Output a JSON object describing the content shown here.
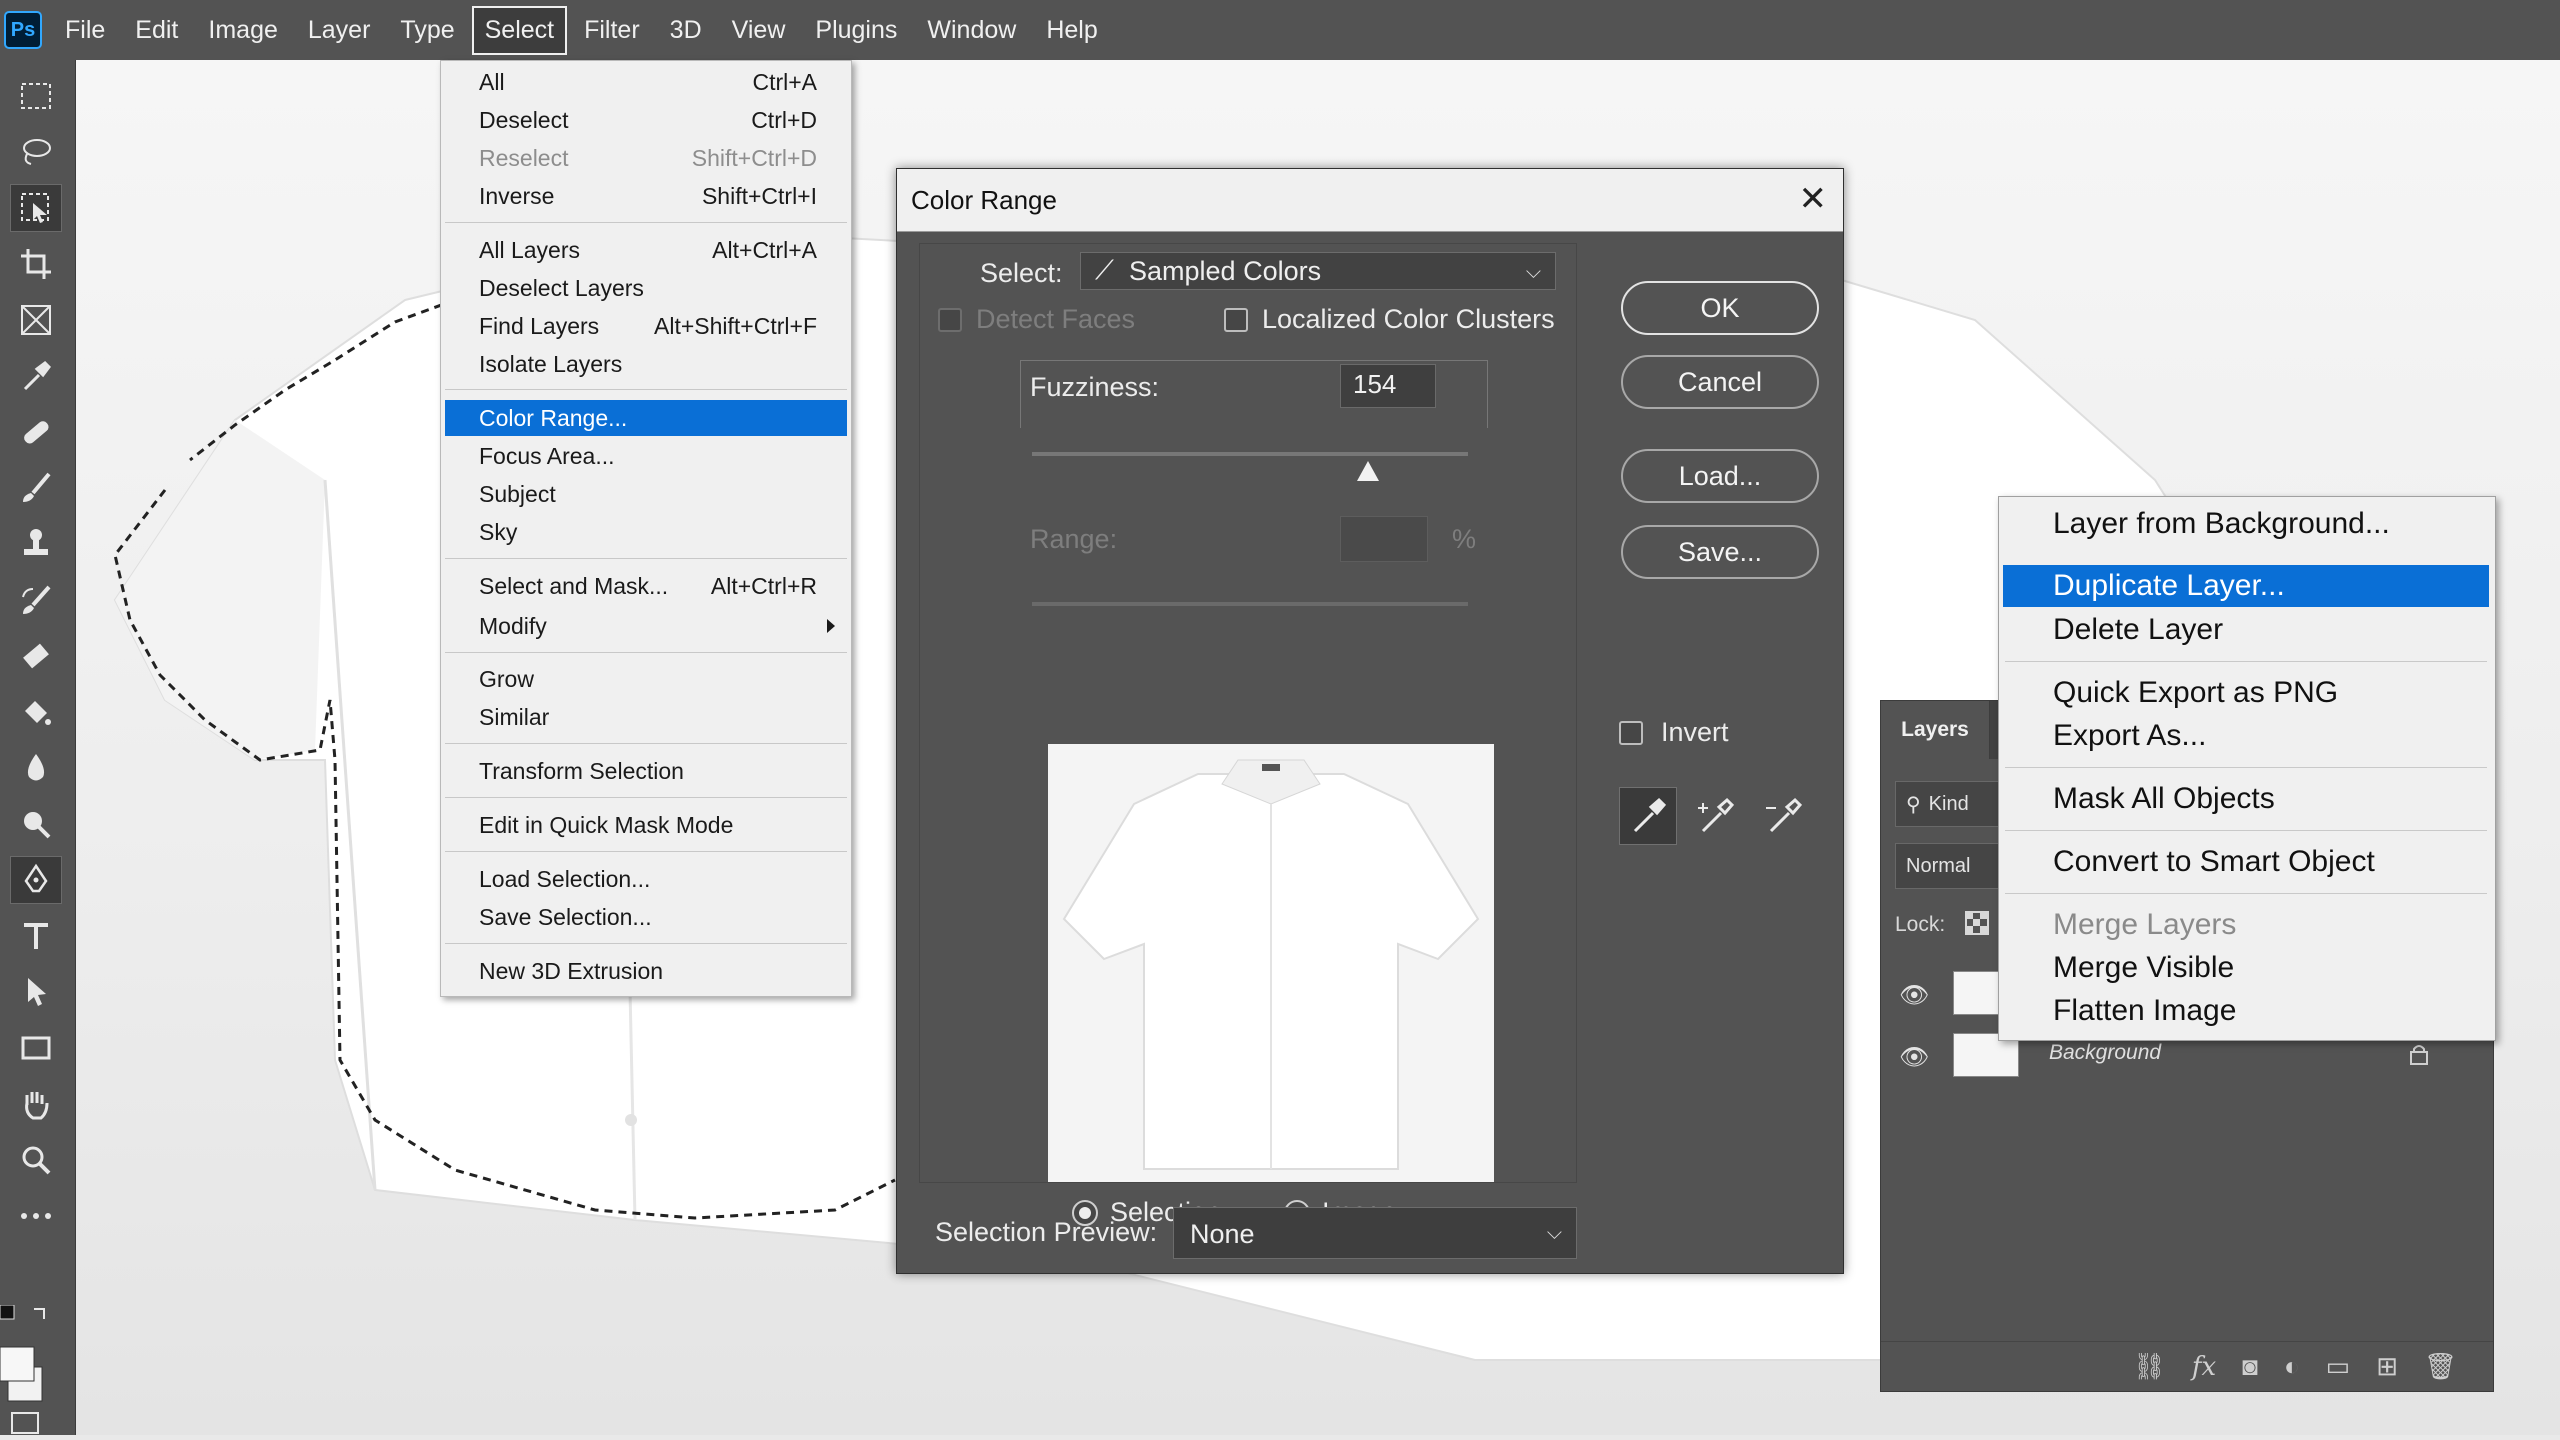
{
  "app": {
    "logo": "Ps"
  },
  "menubar": {
    "items": [
      "File",
      "Edit",
      "Image",
      "Layer",
      "Type",
      "Select",
      "Filter",
      "3D",
      "View",
      "Plugins",
      "Window",
      "Help"
    ],
    "active": "Select"
  },
  "select_menu": {
    "items": [
      {
        "label": "All",
        "shortcut": "Ctrl+A"
      },
      {
        "label": "Deselect",
        "shortcut": "Ctrl+D"
      },
      {
        "label": "Reselect",
        "shortcut": "Shift+Ctrl+D",
        "disabled": true
      },
      {
        "label": "Inverse",
        "shortcut": "Shift+Ctrl+I"
      },
      {
        "label": "All Layers",
        "shortcut": "Alt+Ctrl+A"
      },
      {
        "label": "Deselect Layers",
        "shortcut": ""
      },
      {
        "label": "Find Layers",
        "shortcut": "Alt+Shift+Ctrl+F"
      },
      {
        "label": "Isolate Layers",
        "shortcut": ""
      },
      {
        "label": "Color Range...",
        "shortcut": "",
        "highlighted": true
      },
      {
        "label": "Focus Area...",
        "shortcut": ""
      },
      {
        "label": "Subject",
        "shortcut": ""
      },
      {
        "label": "Sky",
        "shortcut": ""
      },
      {
        "label": "Select and Mask...",
        "shortcut": "Alt+Ctrl+R"
      },
      {
        "label": "Modify",
        "shortcut": "",
        "submenu": true
      },
      {
        "label": "Grow",
        "shortcut": ""
      },
      {
        "label": "Similar",
        "shortcut": ""
      },
      {
        "label": "Transform Selection",
        "shortcut": ""
      },
      {
        "label": "Edit in Quick Mask Mode",
        "shortcut": ""
      },
      {
        "label": "Load Selection...",
        "shortcut": ""
      },
      {
        "label": "Save Selection...",
        "shortcut": ""
      },
      {
        "label": "New 3D Extrusion",
        "shortcut": ""
      }
    ]
  },
  "color_range": {
    "title": "Color Range",
    "select_label": "Select:",
    "select_value": "Sampled Colors",
    "detect_faces": "Detect Faces",
    "localized": "Localized Color Clusters",
    "fuzziness_label": "Fuzziness:",
    "fuzziness_value": "154",
    "fuzziness_level": 0.77,
    "range_label": "Range:",
    "range_unit": "%",
    "radio_selection": "Selection",
    "radio_image": "Image",
    "preview_label": "Selection Preview:",
    "preview_value": "None",
    "buttons": {
      "ok": "OK",
      "cancel": "Cancel",
      "load": "Load...",
      "save": "Save..."
    },
    "invert": "Invert"
  },
  "layers_panel": {
    "tab": "Layers",
    "kind": "Kind",
    "blend": "Normal",
    "lock": "Lock:",
    "layers": [
      "",
      "Background"
    ]
  },
  "context_menu": {
    "items": [
      {
        "label": "Layer from Background..."
      },
      {
        "label": "Duplicate Layer...",
        "highlighted": true
      },
      {
        "label": "Delete Layer"
      },
      {
        "label": "Quick Export as PNG"
      },
      {
        "label": "Export As..."
      },
      {
        "label": "Mask All Objects"
      },
      {
        "label": "Convert to Smart Object"
      },
      {
        "label": "Merge Layers",
        "disabled": true
      },
      {
        "label": "Merge Visible"
      },
      {
        "label": "Flatten Image"
      }
    ]
  },
  "colors": {
    "accent": "#0a6fd6",
    "panel": "#535353",
    "menu": "#f0f0f0"
  }
}
